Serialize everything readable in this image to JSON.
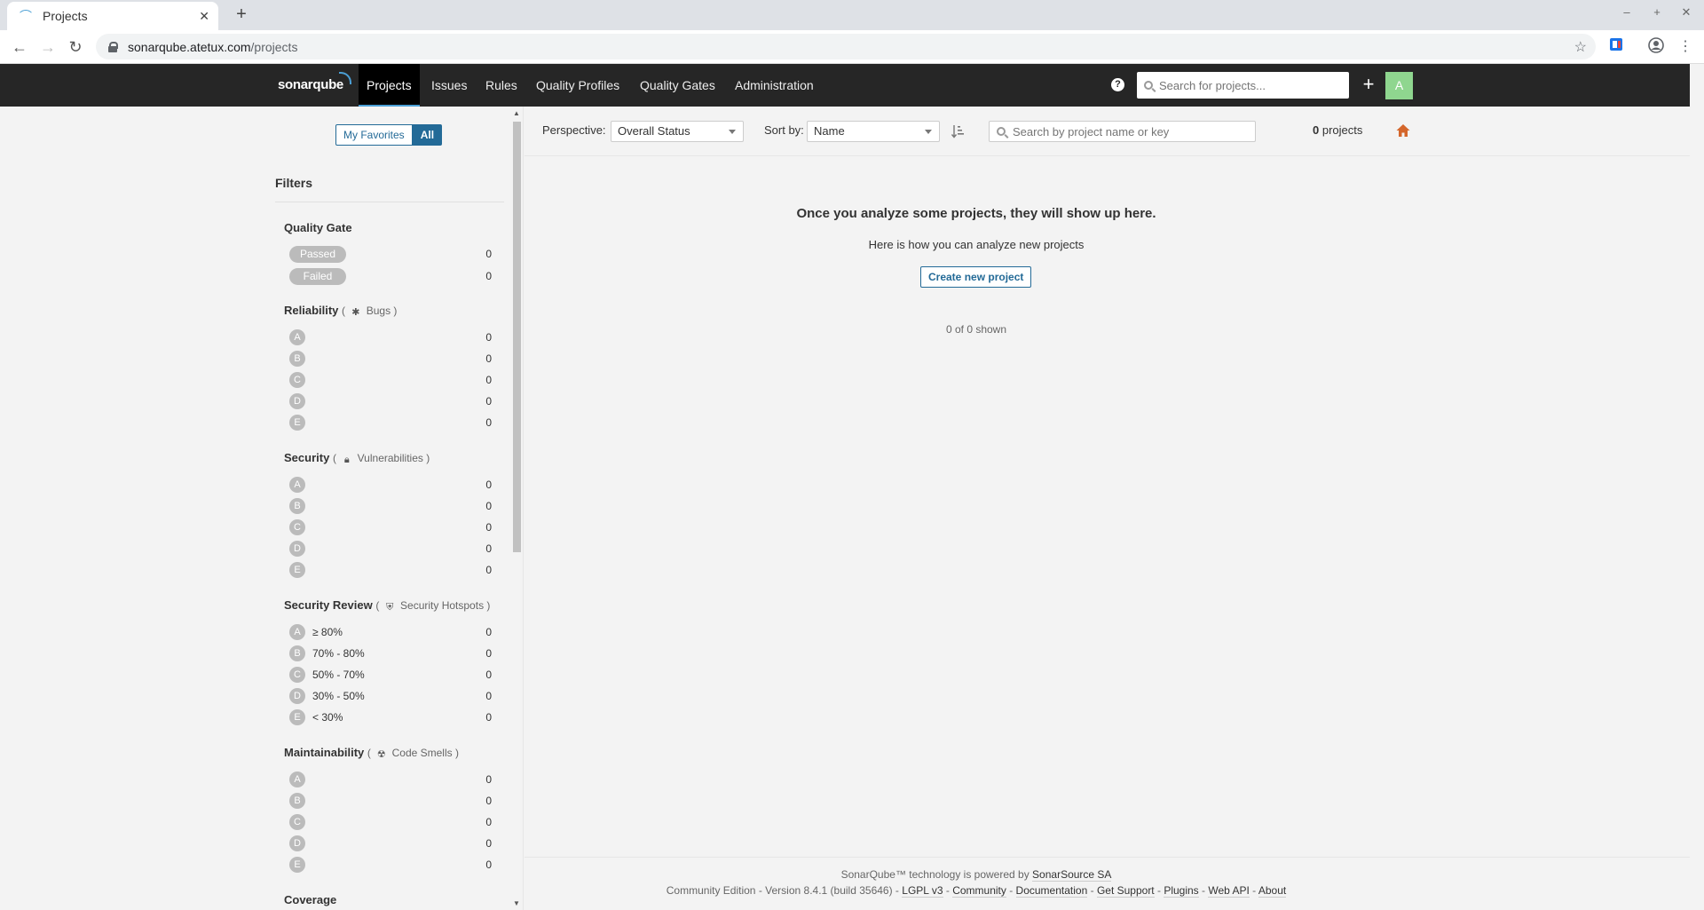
{
  "browser": {
    "tab_title": "Projects",
    "url_host": "sonarqube.atetux.com",
    "url_path": "/projects"
  },
  "nav": {
    "logo": "sonarqube",
    "items": [
      "Projects",
      "Issues",
      "Rules",
      "Quality Profiles",
      "Quality Gates",
      "Administration"
    ],
    "active": "Projects",
    "search_placeholder": "Search for projects...",
    "avatar": "A",
    "accent": "#4b9fd5"
  },
  "sidebar": {
    "fav_toggle": {
      "my_favorites": "My Favorites",
      "all": "All",
      "selected": "All"
    },
    "filters_title": "Filters",
    "quality_gate": {
      "title": "Quality Gate",
      "options": [
        {
          "label": "Passed",
          "count": "0"
        },
        {
          "label": "Failed",
          "count": "0"
        }
      ]
    },
    "reliability": {
      "title": "Reliability",
      "sub": "Bugs",
      "icon": "bug-icon",
      "grades": [
        {
          "g": "A",
          "count": "0"
        },
        {
          "g": "B",
          "count": "0"
        },
        {
          "g": "C",
          "count": "0"
        },
        {
          "g": "D",
          "count": "0"
        },
        {
          "g": "E",
          "count": "0"
        }
      ]
    },
    "security": {
      "title": "Security",
      "sub": "Vulnerabilities",
      "icon": "lock-icon",
      "grades": [
        {
          "g": "A",
          "count": "0"
        },
        {
          "g": "B",
          "count": "0"
        },
        {
          "g": "C",
          "count": "0"
        },
        {
          "g": "D",
          "count": "0"
        },
        {
          "g": "E",
          "count": "0"
        }
      ]
    },
    "security_review": {
      "title": "Security Review",
      "sub": "Security Hotspots",
      "icon": "shield-icon",
      "grades": [
        {
          "g": "A",
          "range": "≥ 80%",
          "count": "0"
        },
        {
          "g": "B",
          "range": "70% - 80%",
          "count": "0"
        },
        {
          "g": "C",
          "range": "50% - 70%",
          "count": "0"
        },
        {
          "g": "D",
          "range": "30% - 50%",
          "count": "0"
        },
        {
          "g": "E",
          "range": "< 30%",
          "count": "0"
        }
      ]
    },
    "maintainability": {
      "title": "Maintainability",
      "sub": "Code Smells",
      "icon": "code-smell-icon",
      "grades": [
        {
          "g": "A",
          "count": "0"
        },
        {
          "g": "B",
          "count": "0"
        },
        {
          "g": "C",
          "count": "0"
        },
        {
          "g": "D",
          "count": "0"
        },
        {
          "g": "E",
          "count": "0"
        }
      ]
    },
    "coverage": {
      "title": "Coverage"
    }
  },
  "main": {
    "perspective_label": "Perspective:",
    "perspective_value": "Overall Status",
    "sort_label": "Sort by:",
    "sort_value": "Name",
    "search_placeholder": "Search by project name or key",
    "project_count": "0",
    "project_count_suffix": "projects",
    "empty_title": "Once you analyze some projects, they will show up here.",
    "empty_sub": "Here is how you can analyze new projects",
    "create_button": "Create new project",
    "shown": "0 of 0 shown"
  },
  "footer": {
    "line1_prefix": "SonarQube™ technology is powered by",
    "line1_link": "SonarSource SA",
    "edition": "Community Edition",
    "version": "Version 8.4.1 (build 35646)",
    "links": [
      "LGPL v3",
      "Community",
      "Documentation",
      "Get Support",
      "Plugins",
      "Web API",
      "About"
    ]
  }
}
